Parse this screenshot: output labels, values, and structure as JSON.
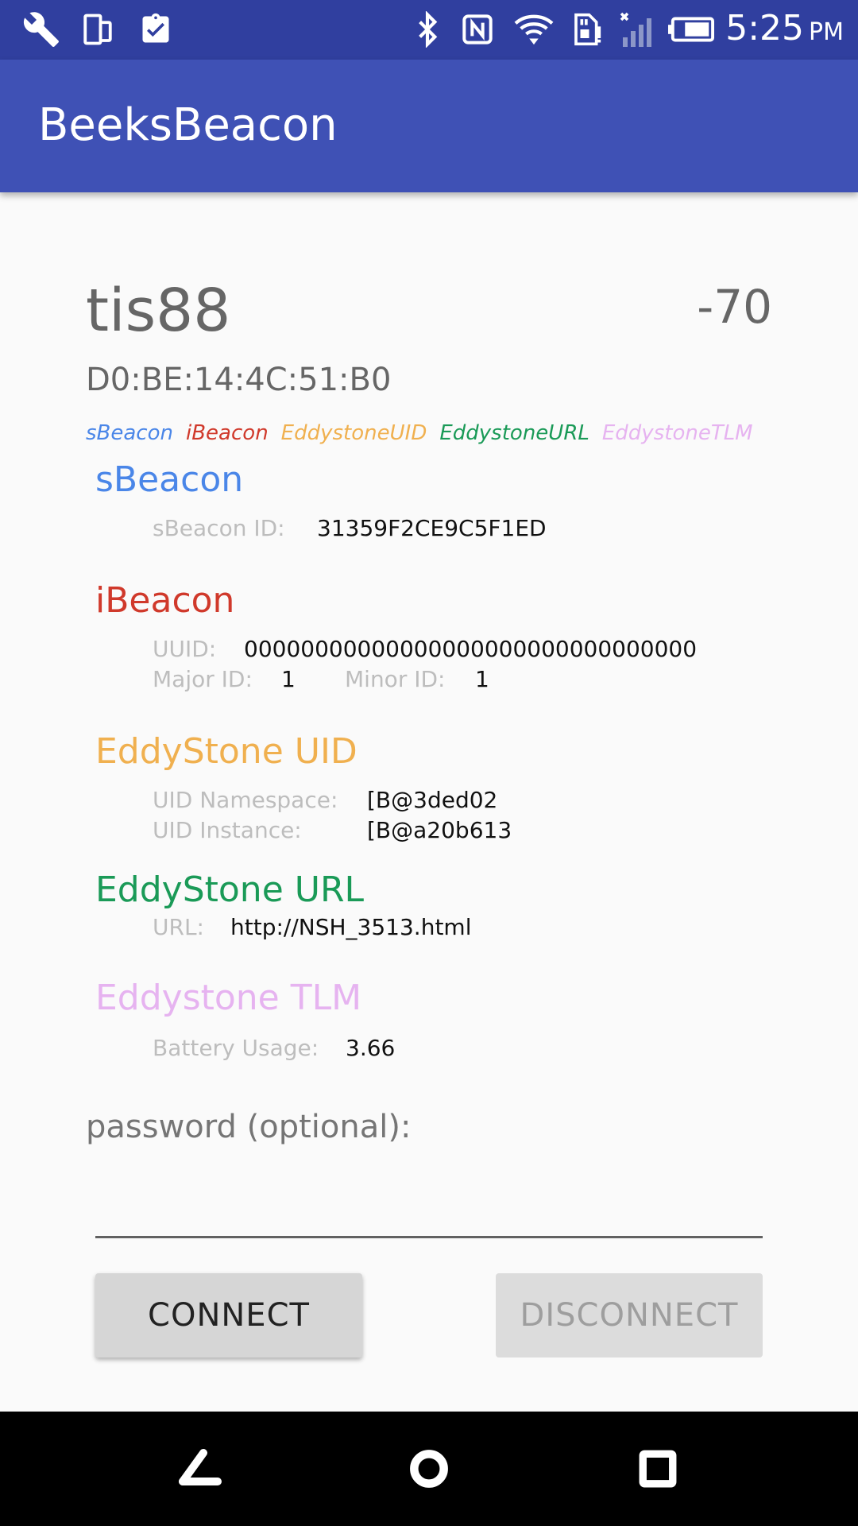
{
  "status_bar": {
    "time": "5:25",
    "ampm": "PM",
    "left_icons": [
      "wrench-icon",
      "device-icon",
      "clipboard-check-icon"
    ],
    "right_icons": [
      "bluetooth-icon",
      "nfc-icon",
      "wifi-icon",
      "sd-card-alert-icon",
      "signal-icon",
      "battery-icon"
    ]
  },
  "app_bar": {
    "title": "BeeksBeacon"
  },
  "device": {
    "name": "tis88",
    "rssi": "-70",
    "mac": "D0:BE:14:4C:51:B0"
  },
  "legend": [
    {
      "label": "sBeacon",
      "color": "#4a86e8"
    },
    {
      "label": "iBeacon",
      "color": "#d0392b"
    },
    {
      "label": "EddystoneUID",
      "color": "#f0b04f"
    },
    {
      "label": "EddystoneURL",
      "color": "#1a9a57"
    },
    {
      "label": "EddystoneTLM",
      "color": "#e6b3f0"
    }
  ],
  "sbeacon": {
    "title": "sBeacon",
    "id_label": "sBeacon ID:",
    "id_value": "31359F2CE9C5F1ED"
  },
  "ibeacon": {
    "title": "iBeacon",
    "uuid_label": "UUID:",
    "uuid_value": "00000000000000000000000000000000",
    "major_label": "Major ID:",
    "major_value": "1",
    "minor_label": "Minor ID:",
    "minor_value": "1"
  },
  "eddystone_uid": {
    "title": "EddyStone UID",
    "namespace_label": "UID Namespace:",
    "namespace_value": "[B@3ded02",
    "instance_label": "UID Instance:",
    "instance_value": "[B@a20b613"
  },
  "eddystone_url": {
    "title": "EddyStone URL",
    "url_label": "URL:",
    "url_value": "http://NSH_3513.html"
  },
  "eddystone_tlm": {
    "title": "Eddystone TLM",
    "battery_label": "Battery Usage:",
    "battery_value": "3.66"
  },
  "password": {
    "label": "password (optional):",
    "value": ""
  },
  "buttons": {
    "connect": "CONNECT",
    "disconnect": "DISCONNECT"
  },
  "nav": [
    "back-icon",
    "home-icon",
    "recents-icon"
  ]
}
